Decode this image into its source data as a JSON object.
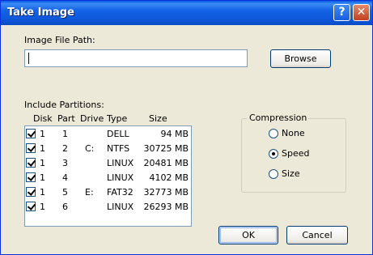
{
  "window": {
    "title": "Take Image"
  },
  "titlebar": {
    "help_glyph": "?",
    "close_glyph": "✕"
  },
  "image_path": {
    "label": "Image File Path:",
    "value": ""
  },
  "browse": {
    "label": "Browse"
  },
  "partitions": {
    "label": "Include Partitions:",
    "columns": [
      "Disk",
      "Part",
      "Drive",
      "Type",
      "Size"
    ],
    "rows": [
      {
        "checked": true,
        "disk": "1",
        "part": "1",
        "drive": "",
        "type": "DELL",
        "size": "94 MB"
      },
      {
        "checked": true,
        "disk": "1",
        "part": "2",
        "drive": "C:",
        "type": "NTFS",
        "size": "30725 MB"
      },
      {
        "checked": true,
        "disk": "1",
        "part": "3",
        "drive": "",
        "type": "LINUX",
        "size": "20481 MB"
      },
      {
        "checked": true,
        "disk": "1",
        "part": "4",
        "drive": "",
        "type": "LINUX",
        "size": "4102 MB"
      },
      {
        "checked": true,
        "disk": "1",
        "part": "5",
        "drive": "E:",
        "type": "FAT32",
        "size": "32773 MB"
      },
      {
        "checked": true,
        "disk": "1",
        "part": "6",
        "drive": "",
        "type": "LINUX",
        "size": "26293 MB"
      }
    ]
  },
  "compression": {
    "label": "Compression",
    "options": [
      "None",
      "Speed",
      "Size"
    ],
    "selected": "Speed"
  },
  "buttons": {
    "ok": "OK",
    "cancel": "Cancel"
  }
}
